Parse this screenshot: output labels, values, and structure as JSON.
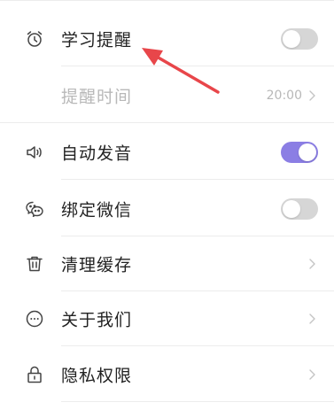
{
  "settings": {
    "items": [
      {
        "label": "学习提醒",
        "icon": "alarm-clock-icon",
        "control": "toggle",
        "on": false
      },
      {
        "label": "提醒时间",
        "value": "20:00",
        "control": "chevron",
        "disabled": true
      },
      {
        "label": "自动发音",
        "icon": "speaker-icon",
        "control": "toggle",
        "on": true
      },
      {
        "label": "绑定微信",
        "icon": "wechat-icon",
        "control": "toggle",
        "on": false
      },
      {
        "label": "清理缓存",
        "icon": "trash-icon",
        "control": "chevron"
      },
      {
        "label": "关于我们",
        "icon": "info-dots-icon",
        "control": "chevron"
      },
      {
        "label": "隐私权限",
        "icon": "lock-icon",
        "control": "chevron"
      }
    ]
  },
  "colors": {
    "toggle_on": "#8b7ee4",
    "toggle_off": "#d6d6d6",
    "annotation_arrow": "#e8464a"
  }
}
